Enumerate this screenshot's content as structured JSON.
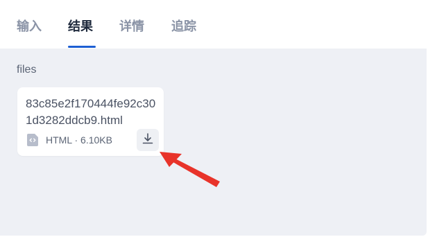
{
  "tabs": [
    {
      "label": "输入",
      "active": false
    },
    {
      "label": "结果",
      "active": true
    },
    {
      "label": "详情",
      "active": false
    },
    {
      "label": "追踪",
      "active": false
    }
  ],
  "result": {
    "section_title": "files",
    "file": {
      "name": "83c85e2f170444fe92c301d3282ddcb9.html",
      "type": "HTML",
      "size": "6.10KB",
      "meta": "HTML · 6.10KB",
      "icon": "html-file-icon",
      "action_icon": "download-icon"
    }
  },
  "colors": {
    "active_tab": "#1f2a3d",
    "inactive_tab": "#8a93a6",
    "accent": "#1d5fd3",
    "panel_bg": "#eef0f5",
    "annotation_arrow": "#e8332a"
  }
}
